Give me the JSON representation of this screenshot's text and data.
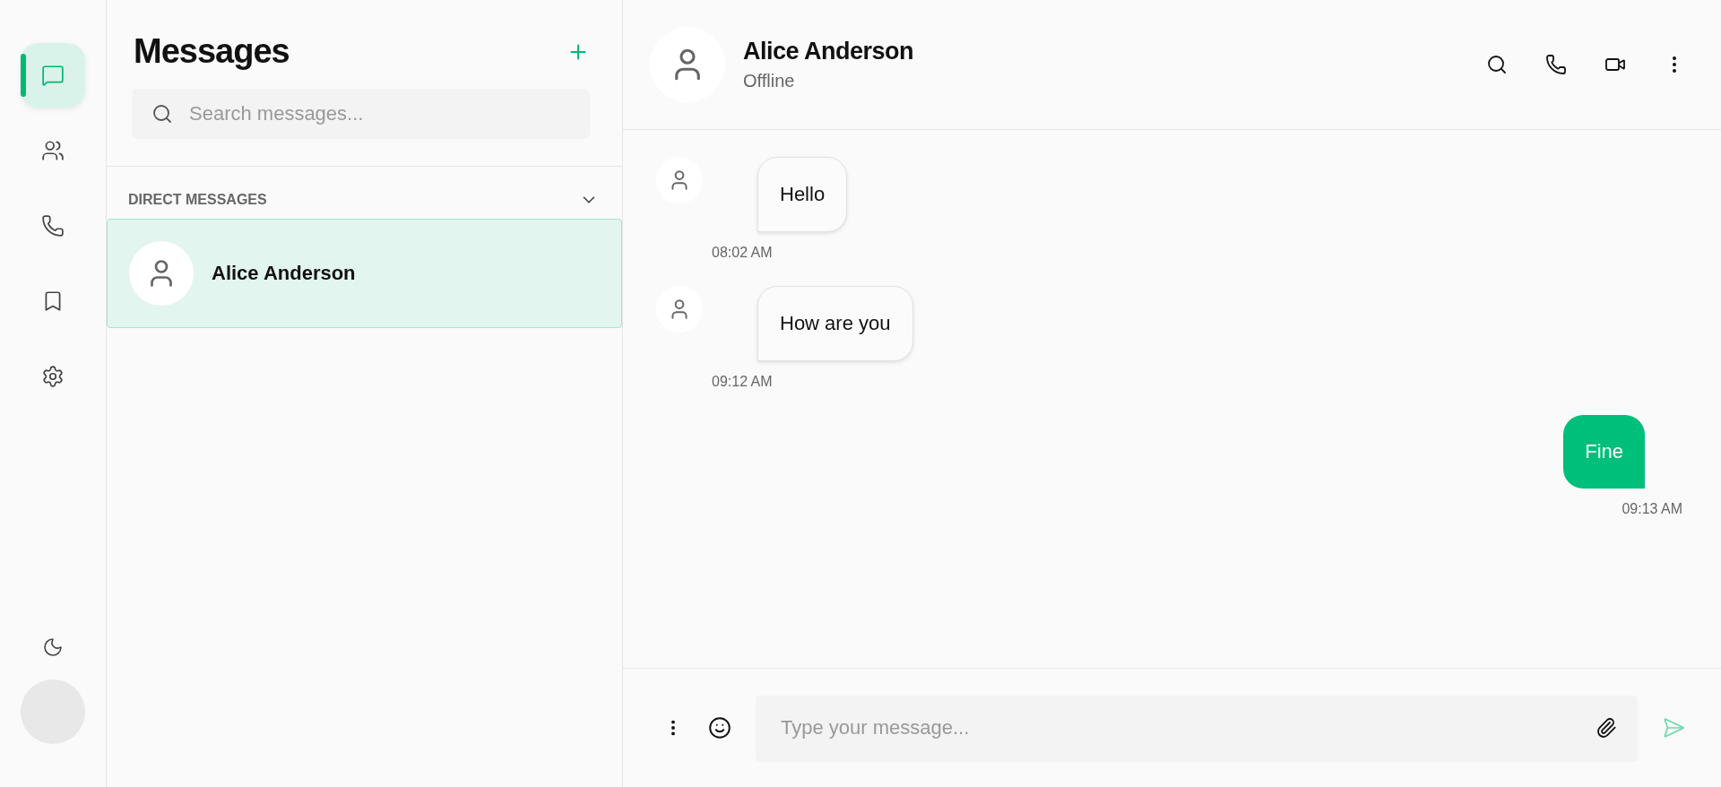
{
  "rail": {
    "items": [
      {
        "kind": "chat",
        "selected": true
      },
      {
        "kind": "contacts",
        "selected": false
      },
      {
        "kind": "calls",
        "selected": false
      },
      {
        "kind": "bookmarks",
        "selected": false
      },
      {
        "kind": "settings",
        "selected": false
      }
    ]
  },
  "sidebar": {
    "title": "Messages",
    "search": {
      "placeholder": "Search messages..."
    },
    "section": {
      "label": "DIRECT MESSAGES",
      "expanded": true
    },
    "conversations": [
      {
        "name": "Alice Anderson",
        "selected": true
      }
    ]
  },
  "chat": {
    "contact": {
      "name": "Alice Anderson",
      "status": "Offline"
    },
    "messages": [
      {
        "kind": "incoming",
        "text": "Hello",
        "time": "08:02 AM"
      },
      {
        "kind": "incoming",
        "text": "How are you",
        "time": "09:12 AM"
      },
      {
        "kind": "outgoing",
        "text": "Fine",
        "time": "09:13 AM"
      }
    ],
    "composer": {
      "placeholder": "Type your message..."
    }
  }
}
